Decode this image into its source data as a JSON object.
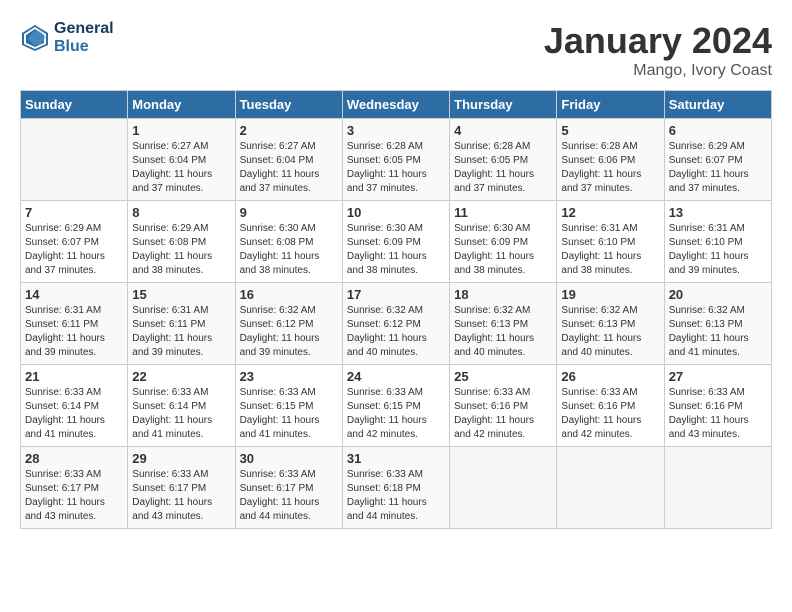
{
  "logo": {
    "line1": "General",
    "line2": "Blue"
  },
  "title": "January 2024",
  "subtitle": "Mango, Ivory Coast",
  "days_of_week": [
    "Sunday",
    "Monday",
    "Tuesday",
    "Wednesday",
    "Thursday",
    "Friday",
    "Saturday"
  ],
  "weeks": [
    [
      {
        "day": "",
        "sunrise": "",
        "sunset": "",
        "daylight": ""
      },
      {
        "day": "1",
        "sunrise": "Sunrise: 6:27 AM",
        "sunset": "Sunset: 6:04 PM",
        "daylight": "Daylight: 11 hours and 37 minutes."
      },
      {
        "day": "2",
        "sunrise": "Sunrise: 6:27 AM",
        "sunset": "Sunset: 6:04 PM",
        "daylight": "Daylight: 11 hours and 37 minutes."
      },
      {
        "day": "3",
        "sunrise": "Sunrise: 6:28 AM",
        "sunset": "Sunset: 6:05 PM",
        "daylight": "Daylight: 11 hours and 37 minutes."
      },
      {
        "day": "4",
        "sunrise": "Sunrise: 6:28 AM",
        "sunset": "Sunset: 6:05 PM",
        "daylight": "Daylight: 11 hours and 37 minutes."
      },
      {
        "day": "5",
        "sunrise": "Sunrise: 6:28 AM",
        "sunset": "Sunset: 6:06 PM",
        "daylight": "Daylight: 11 hours and 37 minutes."
      },
      {
        "day": "6",
        "sunrise": "Sunrise: 6:29 AM",
        "sunset": "Sunset: 6:07 PM",
        "daylight": "Daylight: 11 hours and 37 minutes."
      }
    ],
    [
      {
        "day": "7",
        "sunrise": "Sunrise: 6:29 AM",
        "sunset": "Sunset: 6:07 PM",
        "daylight": "Daylight: 11 hours and 37 minutes."
      },
      {
        "day": "8",
        "sunrise": "Sunrise: 6:29 AM",
        "sunset": "Sunset: 6:08 PM",
        "daylight": "Daylight: 11 hours and 38 minutes."
      },
      {
        "day": "9",
        "sunrise": "Sunrise: 6:30 AM",
        "sunset": "Sunset: 6:08 PM",
        "daylight": "Daylight: 11 hours and 38 minutes."
      },
      {
        "day": "10",
        "sunrise": "Sunrise: 6:30 AM",
        "sunset": "Sunset: 6:09 PM",
        "daylight": "Daylight: 11 hours and 38 minutes."
      },
      {
        "day": "11",
        "sunrise": "Sunrise: 6:30 AM",
        "sunset": "Sunset: 6:09 PM",
        "daylight": "Daylight: 11 hours and 38 minutes."
      },
      {
        "day": "12",
        "sunrise": "Sunrise: 6:31 AM",
        "sunset": "Sunset: 6:10 PM",
        "daylight": "Daylight: 11 hours and 38 minutes."
      },
      {
        "day": "13",
        "sunrise": "Sunrise: 6:31 AM",
        "sunset": "Sunset: 6:10 PM",
        "daylight": "Daylight: 11 hours and 39 minutes."
      }
    ],
    [
      {
        "day": "14",
        "sunrise": "Sunrise: 6:31 AM",
        "sunset": "Sunset: 6:11 PM",
        "daylight": "Daylight: 11 hours and 39 minutes."
      },
      {
        "day": "15",
        "sunrise": "Sunrise: 6:31 AM",
        "sunset": "Sunset: 6:11 PM",
        "daylight": "Daylight: 11 hours and 39 minutes."
      },
      {
        "day": "16",
        "sunrise": "Sunrise: 6:32 AM",
        "sunset": "Sunset: 6:12 PM",
        "daylight": "Daylight: 11 hours and 39 minutes."
      },
      {
        "day": "17",
        "sunrise": "Sunrise: 6:32 AM",
        "sunset": "Sunset: 6:12 PM",
        "daylight": "Daylight: 11 hours and 40 minutes."
      },
      {
        "day": "18",
        "sunrise": "Sunrise: 6:32 AM",
        "sunset": "Sunset: 6:13 PM",
        "daylight": "Daylight: 11 hours and 40 minutes."
      },
      {
        "day": "19",
        "sunrise": "Sunrise: 6:32 AM",
        "sunset": "Sunset: 6:13 PM",
        "daylight": "Daylight: 11 hours and 40 minutes."
      },
      {
        "day": "20",
        "sunrise": "Sunrise: 6:32 AM",
        "sunset": "Sunset: 6:13 PM",
        "daylight": "Daylight: 11 hours and 41 minutes."
      }
    ],
    [
      {
        "day": "21",
        "sunrise": "Sunrise: 6:33 AM",
        "sunset": "Sunset: 6:14 PM",
        "daylight": "Daylight: 11 hours and 41 minutes."
      },
      {
        "day": "22",
        "sunrise": "Sunrise: 6:33 AM",
        "sunset": "Sunset: 6:14 PM",
        "daylight": "Daylight: 11 hours and 41 minutes."
      },
      {
        "day": "23",
        "sunrise": "Sunrise: 6:33 AM",
        "sunset": "Sunset: 6:15 PM",
        "daylight": "Daylight: 11 hours and 41 minutes."
      },
      {
        "day": "24",
        "sunrise": "Sunrise: 6:33 AM",
        "sunset": "Sunset: 6:15 PM",
        "daylight": "Daylight: 11 hours and 42 minutes."
      },
      {
        "day": "25",
        "sunrise": "Sunrise: 6:33 AM",
        "sunset": "Sunset: 6:16 PM",
        "daylight": "Daylight: 11 hours and 42 minutes."
      },
      {
        "day": "26",
        "sunrise": "Sunrise: 6:33 AM",
        "sunset": "Sunset: 6:16 PM",
        "daylight": "Daylight: 11 hours and 42 minutes."
      },
      {
        "day": "27",
        "sunrise": "Sunrise: 6:33 AM",
        "sunset": "Sunset: 6:16 PM",
        "daylight": "Daylight: 11 hours and 43 minutes."
      }
    ],
    [
      {
        "day": "28",
        "sunrise": "Sunrise: 6:33 AM",
        "sunset": "Sunset: 6:17 PM",
        "daylight": "Daylight: 11 hours and 43 minutes."
      },
      {
        "day": "29",
        "sunrise": "Sunrise: 6:33 AM",
        "sunset": "Sunset: 6:17 PM",
        "daylight": "Daylight: 11 hours and 43 minutes."
      },
      {
        "day": "30",
        "sunrise": "Sunrise: 6:33 AM",
        "sunset": "Sunset: 6:17 PM",
        "daylight": "Daylight: 11 hours and 44 minutes."
      },
      {
        "day": "31",
        "sunrise": "Sunrise: 6:33 AM",
        "sunset": "Sunset: 6:18 PM",
        "daylight": "Daylight: 11 hours and 44 minutes."
      },
      {
        "day": "",
        "sunrise": "",
        "sunset": "",
        "daylight": ""
      },
      {
        "day": "",
        "sunrise": "",
        "sunset": "",
        "daylight": ""
      },
      {
        "day": "",
        "sunrise": "",
        "sunset": "",
        "daylight": ""
      }
    ]
  ]
}
